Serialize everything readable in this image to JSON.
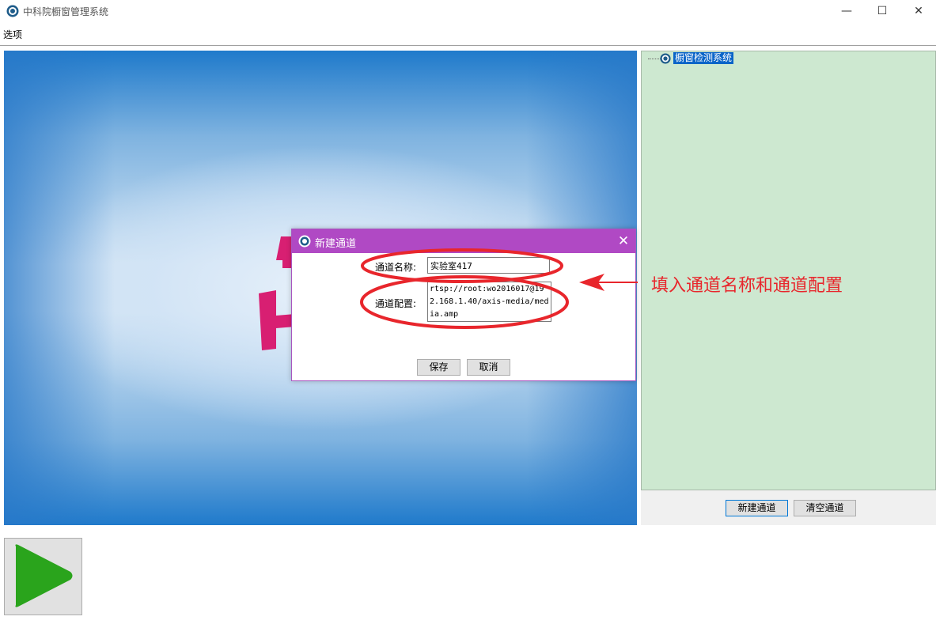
{
  "window": {
    "title": "中科院橱窗管理系统",
    "controls": {
      "minimize": "—",
      "maximize": "☐",
      "close": "✕"
    }
  },
  "menu": {
    "options_label": "选项"
  },
  "tree": {
    "root_label": "橱窗检测系统"
  },
  "right_panel": {
    "new_channel_label": "新建通道",
    "clear_channel_label": "清空通道"
  },
  "dialog": {
    "title": "新建通道",
    "close": "✕",
    "name_label": "通道名称:",
    "name_value": "实验室417",
    "config_label": "通道配置:",
    "config_value": "rtsp://root:wo2016017@192.168.1.40/axis-media/media.amp",
    "save_label": "保存",
    "cancel_label": "取消"
  },
  "annotation": {
    "text": "填入通道名称和通道配置",
    "color": "#e8262c"
  },
  "colors": {
    "dialog_title_bg": "#b049c4",
    "tree_bg": "#cde8d0",
    "selection": "#0a64c8",
    "play_green": "#2aa41c",
    "logo_magenta": "#d81f72"
  },
  "icons": {
    "app": "app-logo-icon",
    "play": "play-icon"
  }
}
